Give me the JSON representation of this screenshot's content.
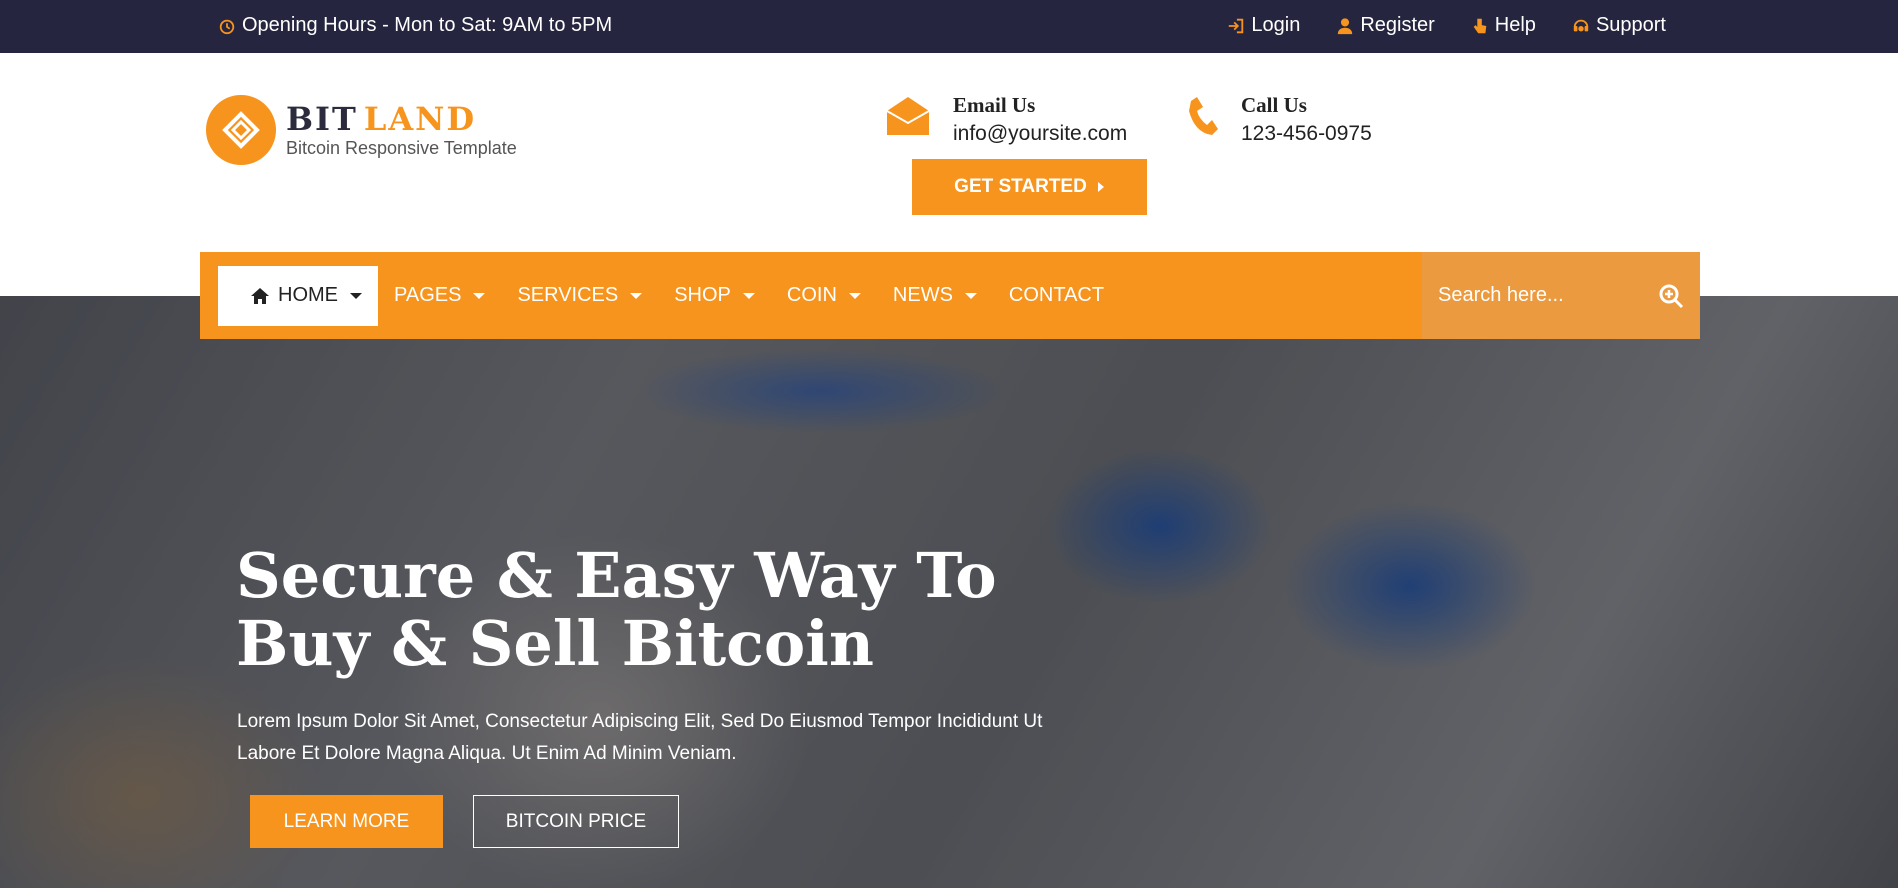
{
  "topbar": {
    "hours": "Opening Hours - Mon to Sat: 9AM to 5PM",
    "links": [
      "Login",
      "Register",
      "Help",
      "Support"
    ]
  },
  "logo": {
    "brand_part1": "BIT",
    "brand_part2": "LAND",
    "tagline": "Bitcoin Responsive Template"
  },
  "contact": {
    "email_label": "Email Us",
    "email_value": "info@yoursite.com",
    "call_label": "Call Us",
    "call_value": "123-456-0975"
  },
  "cta": {
    "get_started": "GET STARTED"
  },
  "nav": {
    "items": [
      "HOME",
      "PAGES",
      "SERVICES",
      "SHOP",
      "COIN",
      "NEWS",
      "CONTACT"
    ],
    "search_placeholder": "Search here..."
  },
  "hero": {
    "title": "Secure & Easy Way To Buy & Sell Bitcoin",
    "text": "Lorem Ipsum Dolor Sit Amet, Consectetur Adipiscing Elit, Sed Do Eiusmod Tempor Incididunt Ut Labore Et Dolore Magna Aliqua. Ut Enim Ad Minim Veniam.",
    "learn_more": "LEARN MORE",
    "bitcoin_price": "BITCOIN PRICE"
  },
  "colors": {
    "accent": "#f7941d",
    "topbar": "#252540",
    "search_bg": "#eb9a3f"
  }
}
